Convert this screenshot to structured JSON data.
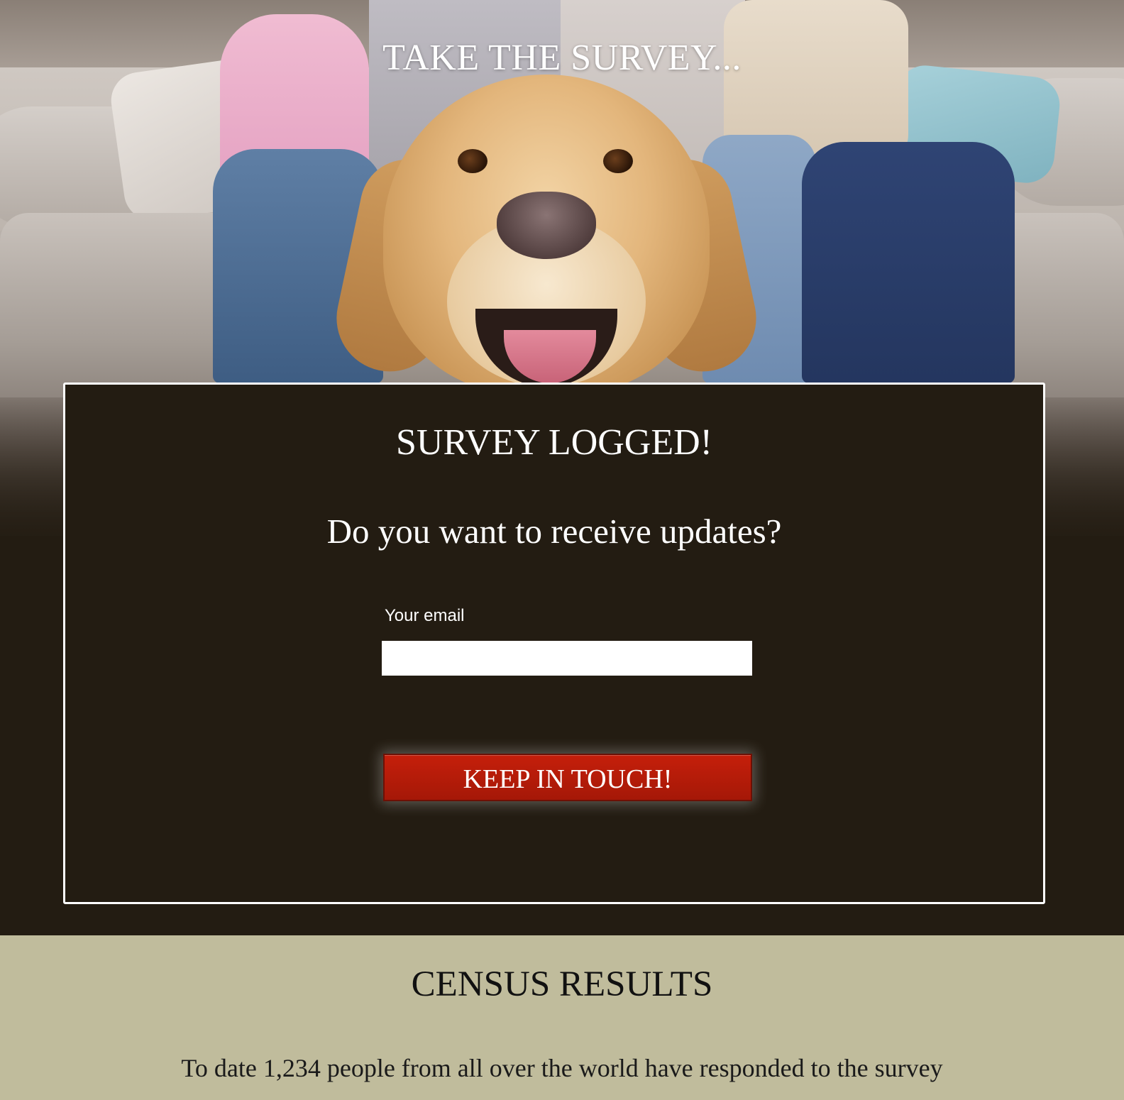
{
  "hero": {
    "title": "TAKE THE SURVEY..."
  },
  "modal": {
    "heading": "SURVEY LOGGED!",
    "question": "Do you want to receive updates?",
    "email_label": "Your email",
    "email_value": "",
    "email_placeholder": "",
    "submit_label": "KEEP IN TOUCH!"
  },
  "census": {
    "title": "CENSUS RESULTS",
    "text": "To date 1,234 people from all over the world have responded to the survey"
  },
  "colors": {
    "page_dark": "#231c12",
    "card_border": "#ffffff",
    "button_red": "#b01a08",
    "census_bg": "#c0bc9c"
  }
}
